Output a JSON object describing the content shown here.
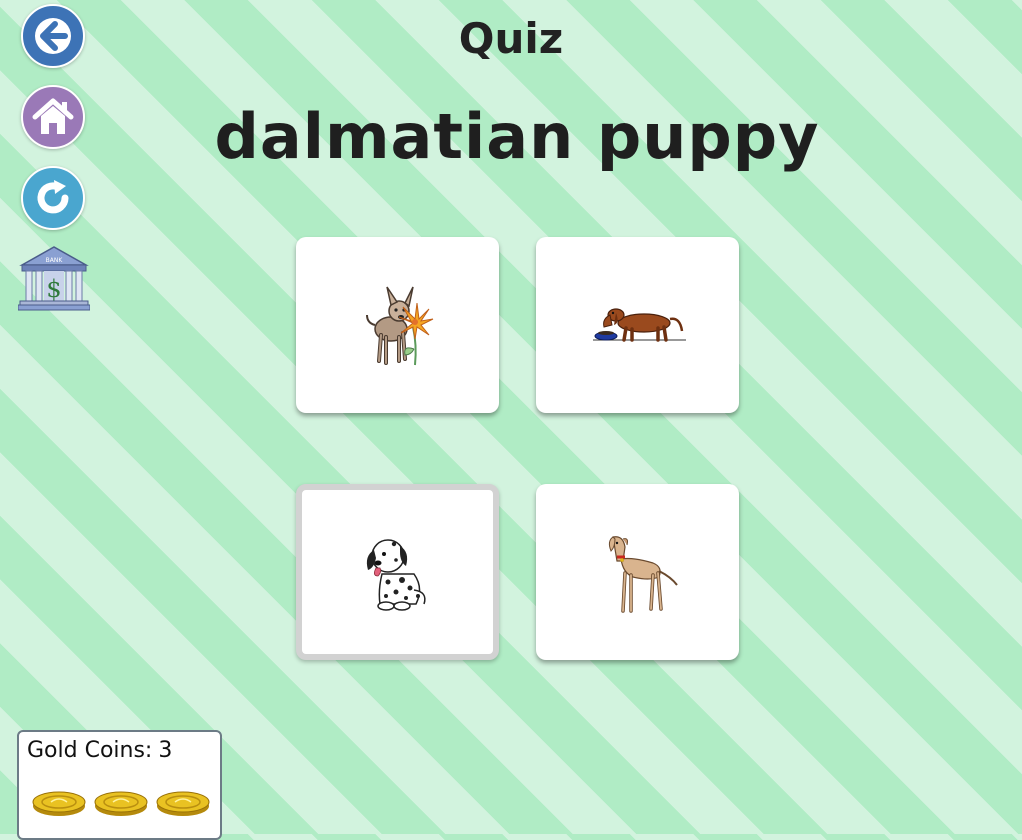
{
  "header": {
    "title": "Quiz",
    "prompt": "dalmatian puppy"
  },
  "nav": [
    {
      "name": "back-button",
      "icon": "arrow-left-icon",
      "color": "#3d73b6"
    },
    {
      "name": "home-button",
      "icon": "home-icon",
      "color": "#9a79b7"
    },
    {
      "name": "reload-button",
      "icon": "refresh-icon",
      "color": "#4aa6cf"
    },
    {
      "name": "bank-button",
      "icon": "bank-icon",
      "sign_text": "BANK"
    }
  ],
  "choices": [
    {
      "image": "chihuahua-with-flower",
      "selected": false
    },
    {
      "image": "dachshund-with-bowl",
      "selected": false
    },
    {
      "image": "dalmatian-puppy",
      "selected": true
    },
    {
      "image": "greyhound",
      "selected": false
    }
  ],
  "coins": {
    "label": "Gold Coins:",
    "count": "3",
    "icons": [
      "gold-coin-icon",
      "gold-coin-icon",
      "gold-coin-icon"
    ]
  },
  "colors": {
    "stripe_light": "#d2f3de",
    "stripe_dark": "#b0ecc5",
    "selected_border": "#d2d2d2",
    "coin_gold": "#e0b816"
  }
}
